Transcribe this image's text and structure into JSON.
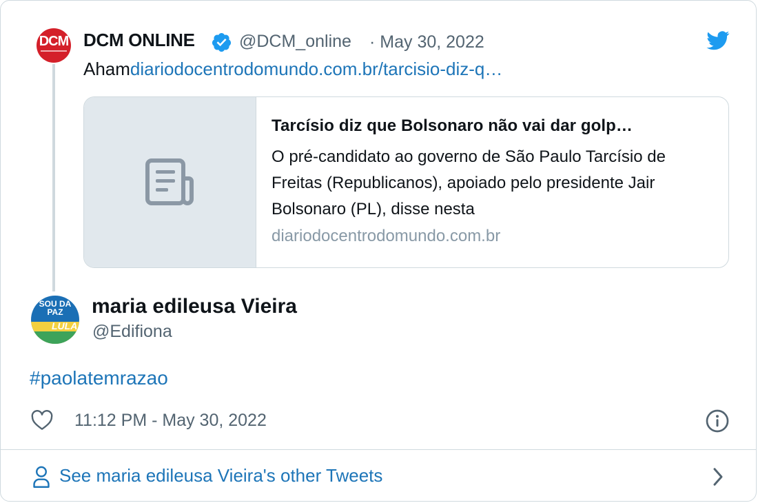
{
  "parent_tweet": {
    "name": "DCM ONLINE",
    "avatar_text": "DCM",
    "handle": "@DCM_online",
    "date": "· May 30, 2022",
    "text_prefix": "Aham",
    "link_text": "diariodocentrodomundo.com.br/tarcisio-diz-q…",
    "link_card": {
      "title": "Tarcísio diz que Bolsonaro não vai dar golp…",
      "description": "O pré-candidato ao governo de São Paulo Tarcísio de Freitas (Republicanos), apoiado pelo presidente Jair Bolsonaro (PL), disse nesta",
      "domain": "diariodocentrodomundo.com.br"
    }
  },
  "reply_tweet": {
    "name": "maria edileusa Vieira",
    "handle": "@Edifiona",
    "avatar_text_top": "SOU DA PAZ",
    "avatar_text_bottom": "LULA",
    "hashtag": "#paolatemrazao",
    "timestamp": "11:12 PM - May 30, 2022"
  },
  "footer": {
    "see_other_label": "See maria edileusa Vieira's other Tweets"
  },
  "colors": {
    "link": "#1d75b8",
    "muted": "#536471",
    "twitter_blue": "#1d9bf0",
    "border": "#cfd9de"
  },
  "icons": [
    "verified-badge-icon",
    "twitter-bird-icon",
    "document-icon",
    "heart-icon",
    "info-icon",
    "person-icon",
    "chevron-right-icon"
  ]
}
